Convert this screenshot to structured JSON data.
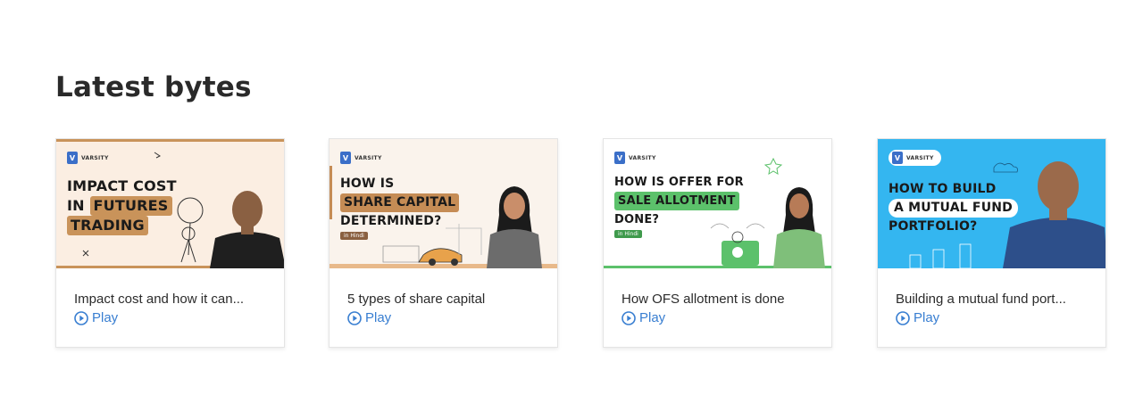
{
  "section": {
    "title": "Latest bytes"
  },
  "cards": [
    {
      "brand": "VARSITY",
      "headline_lines": [
        "IMPACT COST",
        "IN",
        "FUTURES",
        "TRADING"
      ],
      "title": "Impact cost and how it can...",
      "play_label": "Play"
    },
    {
      "brand": "VARSITY",
      "headline_lines": [
        "HOW IS",
        "SHARE CAPITAL",
        "DETERMINED?"
      ],
      "tag": "in Hindi",
      "title": "5 types of share capital",
      "play_label": "Play"
    },
    {
      "brand": "VARSITY",
      "headline_lines": [
        "HOW IS OFFER FOR",
        "SALE ALLOTMENT",
        "DONE?"
      ],
      "tag": "in Hindi",
      "title": "How OFS allotment is done",
      "play_label": "Play"
    },
    {
      "brand": "VARSITY",
      "headline_lines": [
        "HOW TO BUILD",
        "A MUTUAL FUND",
        "PORTFOLIO?"
      ],
      "title": "Building a mutual fund port...",
      "play_label": "Play"
    }
  ],
  "colors": {
    "accent": "#387ed1",
    "card1_bg": "#fbeee2",
    "card1_highlight": "#c9935a",
    "card2_bg": "#faf3ec",
    "card2_highlight": "#c58c55",
    "card3_bg": "#ffffff",
    "card3_highlight": "#5cc16b",
    "card4_bg": "#34b6f0"
  },
  "icons": {
    "play": "play-circle-icon",
    "logo": "varsity-logo-icon"
  }
}
